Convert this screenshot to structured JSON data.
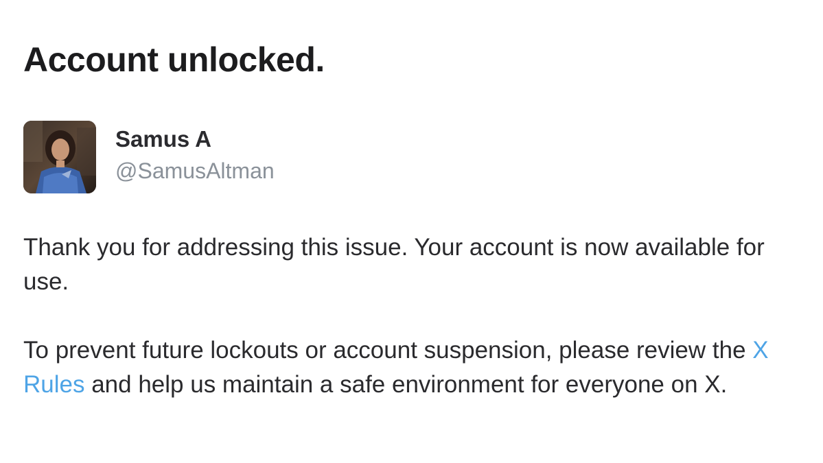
{
  "header": {
    "title": "Account unlocked."
  },
  "profile": {
    "display_name": "Samus A",
    "handle": "@SamusAltman",
    "avatar": "user-avatar-photo"
  },
  "message": {
    "paragraph1": "Thank you for addressing this issue. Your account is now available for use.",
    "paragraph2_before": "To prevent future lockouts or account suspension, please review the ",
    "rules_link_label": "X Rules",
    "paragraph2_after": " and help us maintain a safe environment for everyone on X."
  },
  "colors": {
    "text": "#1c1c1e",
    "handle": "#8a9199",
    "link": "#4ea4e6",
    "background": "#ffffff"
  }
}
